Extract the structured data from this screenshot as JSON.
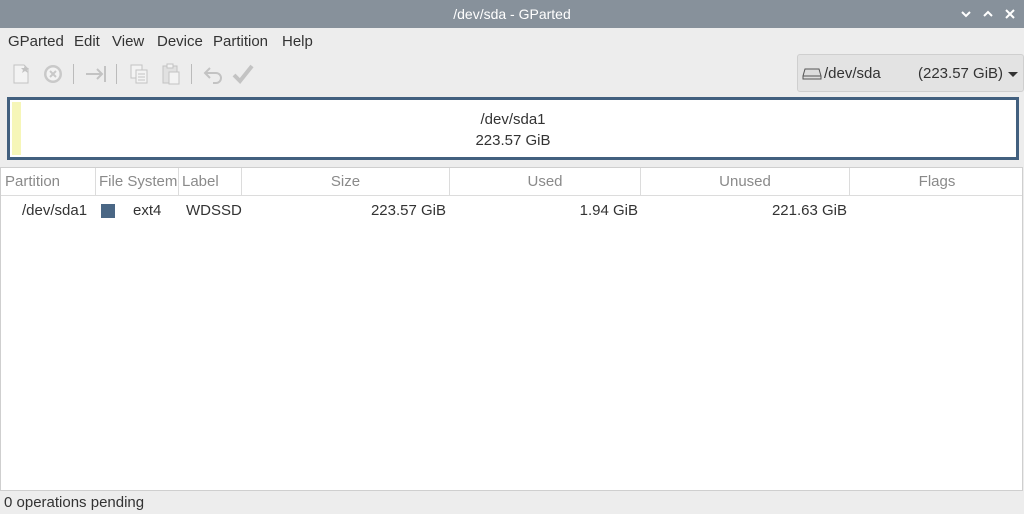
{
  "window": {
    "title": "/dev/sda - GParted",
    "controls": [
      "minimize",
      "maximize",
      "close"
    ]
  },
  "menu": [
    "GParted",
    "Edit",
    "View",
    "Device",
    "Partition",
    "Help"
  ],
  "toolbar": {
    "buttons": [
      {
        "icon": "new-partition-icon",
        "enabled": false
      },
      {
        "icon": "delete-icon",
        "enabled": false
      },
      {
        "icon": "resize-move-icon",
        "enabled": false
      },
      {
        "icon": "copy-icon",
        "enabled": false
      },
      {
        "icon": "paste-icon",
        "enabled": false
      },
      {
        "icon": "undo-icon",
        "enabled": false
      },
      {
        "icon": "apply-icon",
        "enabled": false
      }
    ]
  },
  "device_selector": {
    "icon": "hard-disk-icon",
    "name": "/dev/sda",
    "size": "(223.57 GiB)"
  },
  "disk_map": {
    "partition": "/dev/sda1",
    "size": "223.57 GiB",
    "used_fraction": 0.0087,
    "used_color": "#f6f6b8",
    "border_color": "#42607f"
  },
  "table": {
    "columns": [
      "Partition",
      "File System",
      "Label",
      "Size",
      "Used",
      "Unused",
      "Flags"
    ],
    "rows": [
      {
        "partition": "/dev/sda1",
        "fs_color": "#4a6785",
        "filesystem": "ext4",
        "label": "WDSSD",
        "size": "223.57 GiB",
        "used": "1.94 GiB",
        "unused": "221.63 GiB",
        "flags": ""
      }
    ]
  },
  "status": "0 operations pending"
}
